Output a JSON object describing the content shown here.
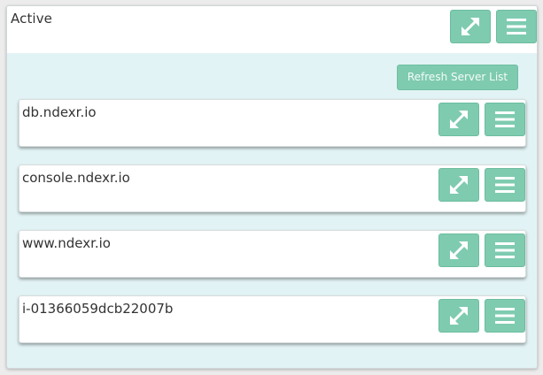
{
  "panel": {
    "title": "Active",
    "refresh_label": "Refresh Server List"
  },
  "servers": [
    {
      "name": "db.ndexr.io"
    },
    {
      "name": "console.ndexr.io"
    },
    {
      "name": "www.ndexr.io"
    },
    {
      "name": "i-01366059dcb22007b"
    }
  ],
  "icons": {
    "expand": "expand-icon",
    "menu": "hamburger-menu-icon"
  },
  "colors": {
    "accent": "#7ecbb0",
    "panel_bg": "#e2f3f5",
    "text": "#333333"
  }
}
